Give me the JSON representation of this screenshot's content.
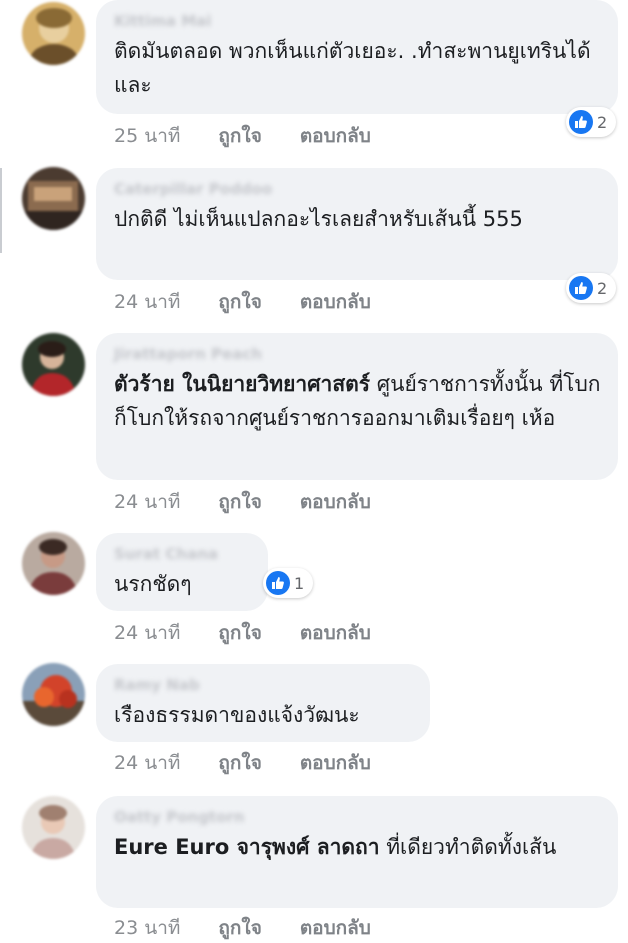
{
  "comments": [
    {
      "author": "Kittima Mai",
      "text_bold": "",
      "text": "ติดมันตลอด พวกเห็นแก่ตัวเยอะ. .ทำสะพานยูเทรินได้และ",
      "time": "25 นาที",
      "like_label": "ถูกใจ",
      "reply_label": "ตอบกลับ",
      "reaction_count": "2",
      "avatar_color": "#c89a48"
    },
    {
      "author": "Caterpillar Poddoo",
      "text_bold": "",
      "text": "ปกติดี ไม่เห็นแปลกอะไรเลยสำหรับเส้นนี้ 555",
      "time": "24 นาที",
      "like_label": "ถูกใจ",
      "reply_label": "ตอบกลับ",
      "reaction_count": "2",
      "avatar_color": "#5d4a3c"
    },
    {
      "author": "Jirattaporn Peach",
      "text_bold": "ตัวร้าย ในนิยายวิทยาศาสตร์",
      "text": " ศูนย์ราชการทั้งนั้น ที่โบกก็โบกให้รถจากศูนย์ราชการออกมาเติมเรื่อยๆ เห้อ",
      "time": "24 นาที",
      "like_label": "ถูกใจ",
      "reply_label": "ตอบกลับ",
      "reaction_count": "",
      "avatar_color": "#3c3a36"
    },
    {
      "author": "Surat Chana",
      "text_bold": "",
      "text": "นรกชัดๆ",
      "time": "24 นาที",
      "like_label": "ถูกใจ",
      "reply_label": "ตอบกลับ",
      "reaction_count": "1",
      "avatar_color": "#9c7c6a"
    },
    {
      "author": "Ramy Nab",
      "text_bold": "",
      "text": "เรืองธรรมดาของแจ้งวัฒนะ",
      "time": "24 นาที",
      "like_label": "ถูกใจ",
      "reply_label": "ตอบกลับ",
      "reaction_count": "",
      "avatar_color": "#c2452c"
    },
    {
      "author": "Oatty Pongtorn",
      "text_bold": "Eure Euro จารุพงศ์ ลาดถา",
      "text": " ที่เดียวทำติดทั้งเส้น",
      "time": "23 นาที",
      "like_label": "ถูกใจ",
      "reply_label": "ตอบกลับ",
      "reaction_count": "",
      "avatar_color": "#d9d3cc"
    }
  ]
}
